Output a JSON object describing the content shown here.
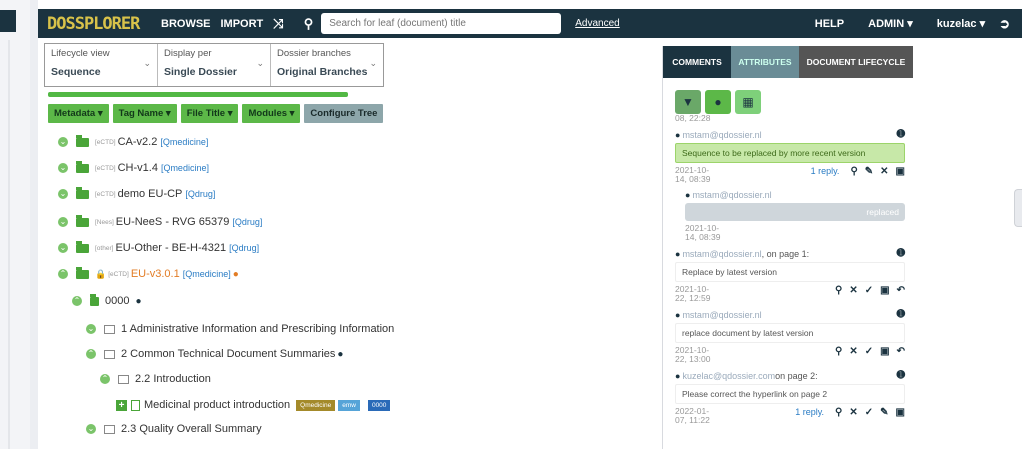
{
  "navbar": {
    "logo": "DOSSPLORER",
    "browse": "BROWSE",
    "import": "IMPORT",
    "search_placeholder": "Search for leaf (document) title",
    "advanced": "Advanced",
    "help": "HELP",
    "admin": "ADMIN ▾",
    "user": "kuzelac ▾"
  },
  "filters": [
    {
      "label": "Lifecycle view",
      "value": "Sequence"
    },
    {
      "label": "Display per",
      "value": "Single Dossier"
    },
    {
      "label": "Dossier branches",
      "value": "Original Branches"
    }
  ],
  "toolbar": {
    "metadata": "Metadata ▾",
    "tag_name": "Tag Name ▾",
    "file_title": "File Title ▾",
    "modules": "Modules ▾",
    "configure": "Configure Tree"
  },
  "tree": {
    "r1": {
      "tag": "[eCTD]",
      "name": "CA-v2.2",
      "product": "[Qmedicine]"
    },
    "r2": {
      "tag": "[eCTD]",
      "name": "CH-v1.4",
      "product": "[Qmedicine]"
    },
    "r3": {
      "tag": "[eCTD]",
      "name": "demo EU-CP",
      "product": "[Qdrug]"
    },
    "r4": {
      "tag": "[Nees]",
      "name": "EU-NeeS - RVG 65379",
      "product": "[Qdrug]"
    },
    "r5": {
      "tag": "[other]",
      "name": "EU-Other - BE-H-4321",
      "product": "[Qdrug]"
    },
    "r6": {
      "tag": "[eCTD]",
      "name": "EU-v3.0.1",
      "product": "[Qmedicine]"
    },
    "r7": {
      "name": "0000"
    },
    "r8": {
      "name": "1 Administrative Information and Prescribing Information"
    },
    "r9": {
      "name": "2 Common Technical Document Summaries"
    },
    "r10": {
      "name": "2.2 Introduction"
    },
    "r11": {
      "name": "Medicinal product introduction",
      "badge1": "Qmedicine",
      "badge2": "emw",
      "badge3": "0000"
    },
    "r12": {
      "name": "2.3 Quality Overall Summary"
    }
  },
  "panel": {
    "tabs": {
      "comments": "COMMENTS",
      "attributes": "ATTRIBUTES",
      "lifecycle": "DOCUMENT LIFECYCLE"
    },
    "top_ts": "08, 22:28",
    "c1": {
      "user": "mstam@qdossier.nl",
      "msg": "Sequence to be replaced by more recent version",
      "date": "2021-10-",
      "date2": "14, 08:39",
      "reply": "1 reply."
    },
    "c1r": {
      "user": "mstam@qdossier.nl",
      "msg": "replaced",
      "date": "2021-10-",
      "date2": "14, 08:39"
    },
    "c2": {
      "user": "mstam@qdossier.nl",
      "page": ", on page 1:",
      "msg": "Replace by latest version",
      "date": "2021-10-",
      "date2": "22, 12:59"
    },
    "c3": {
      "user": "mstam@qdossier.nl",
      "msg": "replace document by latest version",
      "date": "2021-10-",
      "date2": "22, 13:00"
    },
    "c4": {
      "user": "kuzelac@qdossier.com",
      "page": " on page 2:",
      "msg": "Please correct the hyperlink on page 2",
      "date": "2022-01-",
      "date2": "07, 11:22",
      "reply": "1 reply."
    }
  }
}
